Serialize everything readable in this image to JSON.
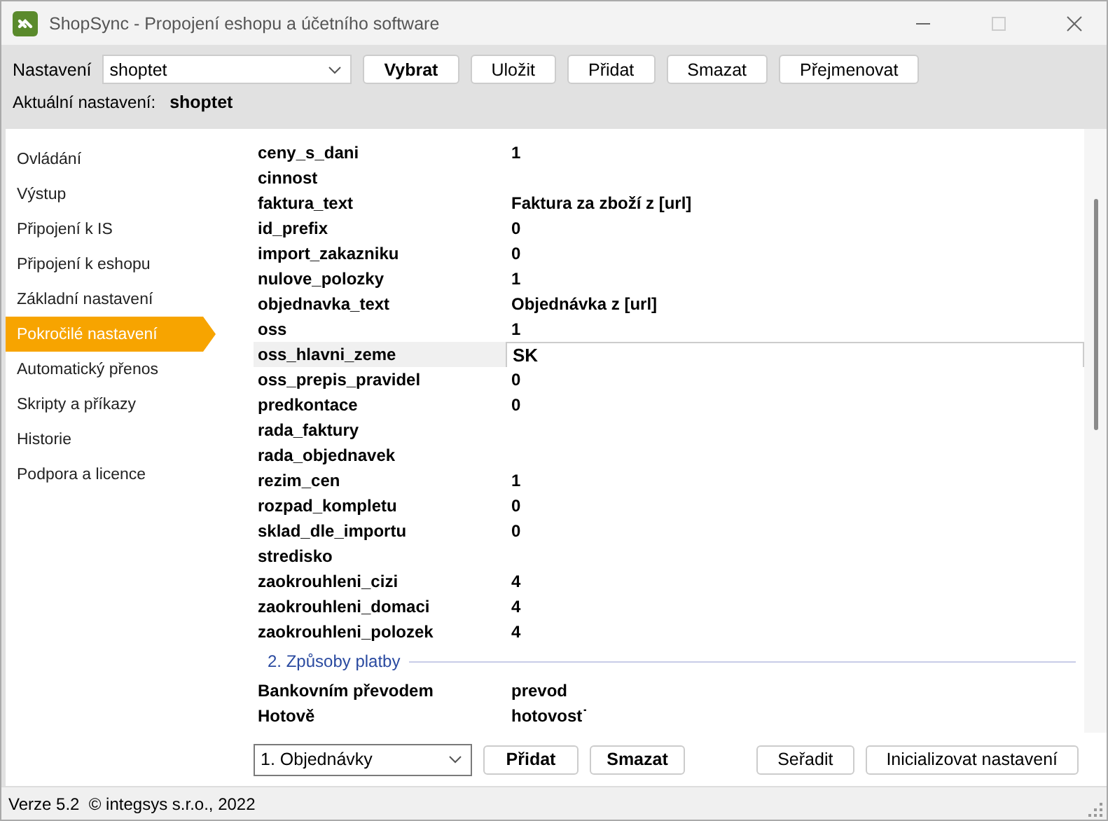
{
  "window": {
    "title": "ShopSync - Propojení eshopu a účetního software"
  },
  "toolbar": {
    "label": "Nastavení",
    "combo_value": "shoptet",
    "buttons": [
      {
        "label": "Vybrat",
        "bold": true
      },
      {
        "label": "Uložit",
        "bold": false
      },
      {
        "label": "Přidat",
        "bold": false
      },
      {
        "label": "Smazat",
        "bold": false
      },
      {
        "label": "Přejmenovat",
        "bold": false
      }
    ],
    "current_label": "Aktuální nastavení:",
    "current_value": "shoptet"
  },
  "sidebar": {
    "items": [
      {
        "label": "Ovládání",
        "selected": false
      },
      {
        "label": "Výstup",
        "selected": false
      },
      {
        "label": "Připojení k IS",
        "selected": false
      },
      {
        "label": "Připojení k eshopu",
        "selected": false
      },
      {
        "label": "Základní nastavení",
        "selected": false
      },
      {
        "label": "Pokročilé nastavení",
        "selected": true
      },
      {
        "label": "Automatický přenos",
        "selected": false
      },
      {
        "label": "Skripty a příkazy",
        "selected": false
      },
      {
        "label": "Historie",
        "selected": false
      },
      {
        "label": "Podpora a licence",
        "selected": false
      }
    ]
  },
  "settings": {
    "rows": [
      {
        "key": "ceny_s_dani",
        "value": "1",
        "selected": false
      },
      {
        "key": "cinnost",
        "value": "",
        "selected": false
      },
      {
        "key": "faktura_text",
        "value": "Faktura za zboží z [url]",
        "selected": false
      },
      {
        "key": "id_prefix",
        "value": "0",
        "selected": false
      },
      {
        "key": "import_zakazniku",
        "value": "0",
        "selected": false
      },
      {
        "key": "nulove_polozky",
        "value": "1",
        "selected": false
      },
      {
        "key": "objednavka_text",
        "value": "Objednávka z [url]",
        "selected": false
      },
      {
        "key": "oss",
        "value": "1",
        "selected": false
      },
      {
        "key": "oss_hlavni_zeme",
        "value": "SK",
        "selected": true
      },
      {
        "key": "oss_prepis_pravidel",
        "value": "0",
        "selected": false
      },
      {
        "key": "predkontace",
        "value": "0",
        "selected": false
      },
      {
        "key": "rada_faktury",
        "value": "",
        "selected": false
      },
      {
        "key": "rada_objednavek",
        "value": "",
        "selected": false
      },
      {
        "key": "rezim_cen",
        "value": "1",
        "selected": false
      },
      {
        "key": "rozpad_kompletu",
        "value": "0",
        "selected": false
      },
      {
        "key": "sklad_dle_importu",
        "value": "0",
        "selected": false
      },
      {
        "key": "stredisko",
        "value": "",
        "selected": false
      },
      {
        "key": "zaokrouhleni_cizi",
        "value": "4",
        "selected": false
      },
      {
        "key": "zaokrouhleni_domaci",
        "value": "4",
        "selected": false
      },
      {
        "key": "zaokrouhleni_polozek",
        "value": "4",
        "selected": false
      }
    ],
    "section": "2. Způsoby platby",
    "section_rows": [
      {
        "key": "Bankovním převodem",
        "value": "prevod",
        "selected": false
      },
      {
        "key": "Hotově",
        "value": "hotovost˙",
        "selected": false
      }
    ]
  },
  "bottom": {
    "combo_value": "1. Objednávky",
    "buttons": [
      {
        "label": "Přidat",
        "bold": true
      },
      {
        "label": "Smazat",
        "bold": true
      }
    ],
    "right_buttons": [
      {
        "label": "Seřadit",
        "bold": false
      },
      {
        "label": "Inicializovat nastavení",
        "bold": false
      }
    ]
  },
  "status_bar": {
    "text": "Verze 5.2  © integsys s.r.o., 2022"
  }
}
